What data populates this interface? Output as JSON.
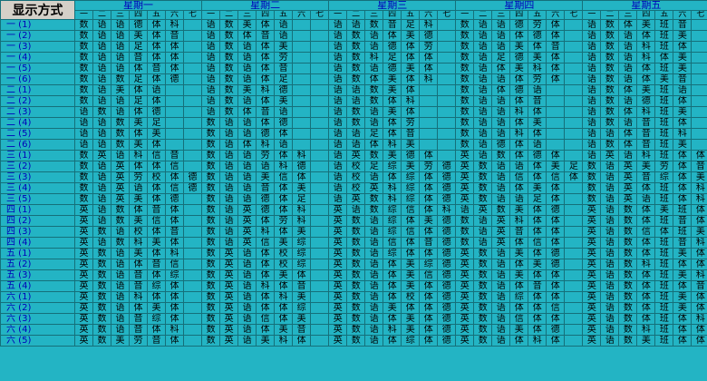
{
  "corner": "显示方式",
  "days": [
    "星期一",
    "星期二",
    "星期三",
    "星期四",
    "星期五"
  ],
  "periods": [
    "一",
    "二",
    "三",
    "四",
    "五",
    "六",
    "七"
  ],
  "rows": [
    {
      "label": "一 (1)",
      "cells": [
        "数",
        "语",
        "语",
        "德",
        "体",
        "科",
        "",
        "语",
        "数",
        "美",
        "体",
        "语",
        "",
        "",
        "语",
        "语",
        "数",
        "音",
        "足",
        "科",
        "",
        "数",
        "语",
        "语",
        "德",
        "劳",
        "体",
        "",
        "语",
        "数",
        "体",
        "美",
        "班",
        "音",
        ""
      ]
    },
    {
      "label": "一 (2)",
      "cells": [
        "数",
        "语",
        "语",
        "美",
        "体",
        "音",
        "",
        "语",
        "数",
        "体",
        "音",
        "语",
        "",
        "",
        "语",
        "数",
        "语",
        "体",
        "美",
        "德",
        "",
        "数",
        "语",
        "语",
        "体",
        "德",
        "体",
        "",
        "语",
        "数",
        "语",
        "体",
        "班",
        "美",
        ""
      ]
    },
    {
      "label": "一 (3)",
      "cells": [
        "数",
        "语",
        "语",
        "足",
        "体",
        "体",
        "",
        "语",
        "数",
        "语",
        "体",
        "美",
        "",
        "",
        "语",
        "数",
        "语",
        "德",
        "体",
        "劳",
        "",
        "数",
        "语",
        "语",
        "美",
        "体",
        "音",
        "",
        "语",
        "数",
        "语",
        "科",
        "班",
        "体",
        ""
      ]
    },
    {
      "label": "一 (4)",
      "cells": [
        "数",
        "语",
        "语",
        "音",
        "体",
        "体",
        "",
        "语",
        "数",
        "语",
        "体",
        "劳",
        "",
        "",
        "语",
        "数",
        "科",
        "足",
        "体",
        "体",
        "",
        "数",
        "语",
        "足",
        "德",
        "美",
        "体",
        "",
        "语",
        "数",
        "语",
        "科",
        "体",
        "美",
        ""
      ]
    },
    {
      "label": "一 (5)",
      "cells": [
        "数",
        "语",
        "语",
        "体",
        "音",
        "体",
        "",
        "语",
        "数",
        "语",
        "体",
        "音",
        "",
        "",
        "语",
        "数",
        "语",
        "德",
        "美",
        "体",
        "",
        "数",
        "语",
        "体",
        "美",
        "科",
        "体",
        "",
        "语",
        "数",
        "语",
        "体",
        "班",
        "美",
        ""
      ]
    },
    {
      "label": "一 (6)",
      "cells": [
        "数",
        "语",
        "数",
        "足",
        "体",
        "德",
        "",
        "语",
        "数",
        "语",
        "体",
        "足",
        "",
        "",
        "语",
        "数",
        "体",
        "美",
        "体",
        "科",
        "",
        "数",
        "语",
        "语",
        "体",
        "劳",
        "体",
        "",
        "语",
        "数",
        "语",
        "体",
        "美",
        "音",
        ""
      ]
    },
    {
      "label": "二 (1)",
      "cells": [
        "数",
        "语",
        "美",
        "体",
        "语",
        "",
        "",
        "语",
        "数",
        "美",
        "科",
        "德",
        "",
        "",
        "语",
        "语",
        "数",
        "美",
        "体",
        "",
        "",
        "数",
        "语",
        "体",
        "德",
        "语",
        "",
        "",
        "语",
        "数",
        "体",
        "美",
        "班",
        "语",
        ""
      ]
    },
    {
      "label": "二 (2)",
      "cells": [
        "数",
        "语",
        "语",
        "足",
        "体",
        "",
        "",
        "语",
        "数",
        "语",
        "体",
        "美",
        "",
        "",
        "语",
        "语",
        "数",
        "体",
        "科",
        "",
        "",
        "数",
        "语",
        "语",
        "体",
        "音",
        "",
        "",
        "语",
        "数",
        "语",
        "德",
        "班",
        "体",
        ""
      ]
    },
    {
      "label": "二 (3)",
      "cells": [
        "语",
        "数",
        "语",
        "体",
        "德",
        "",
        "",
        "语",
        "数",
        "体",
        "音",
        "语",
        "",
        "",
        "语",
        "数",
        "语",
        "美",
        "体",
        "",
        "",
        "数",
        "语",
        "语",
        "科",
        "体",
        "",
        "",
        "语",
        "数",
        "体",
        "科",
        "班",
        "美",
        ""
      ]
    },
    {
      "label": "二 (4)",
      "cells": [
        "语",
        "语",
        "数",
        "美",
        "足",
        "",
        "",
        "数",
        "语",
        "语",
        "体",
        "德",
        "",
        "",
        "语",
        "数",
        "语",
        "体",
        "劳",
        "",
        "",
        "数",
        "语",
        "语",
        "体",
        "美",
        "",
        "",
        "语",
        "数",
        "语",
        "音",
        "班",
        "体",
        ""
      ]
    },
    {
      "label": "二 (5)",
      "cells": [
        "语",
        "语",
        "数",
        "体",
        "美",
        "",
        "",
        "数",
        "语",
        "语",
        "德",
        "体",
        "",
        "",
        "语",
        "语",
        "足",
        "体",
        "音",
        "",
        "",
        "数",
        "语",
        "语",
        "科",
        "体",
        "",
        "",
        "语",
        "语",
        "体",
        "音",
        "班",
        "科",
        ""
      ]
    },
    {
      "label": "二 (6)",
      "cells": [
        "语",
        "语",
        "数",
        "美",
        "体",
        "",
        "",
        "数",
        "语",
        "体",
        "科",
        "语",
        "",
        "",
        "语",
        "语",
        "体",
        "科",
        "美",
        "",
        "",
        "数",
        "语",
        "德",
        "体",
        "语",
        "",
        "",
        "语",
        "数",
        "体",
        "音",
        "班",
        "美",
        ""
      ]
    },
    {
      "label": "三 (1)",
      "cells": [
        "数",
        "英",
        "语",
        "科",
        "信",
        "音",
        "",
        "数",
        "语",
        "语",
        "劳",
        "体",
        "科",
        "",
        "语",
        "英",
        "数",
        "美",
        "德",
        "体",
        "",
        "英",
        "语",
        "数",
        "体",
        "德",
        "体",
        "",
        "语",
        "英",
        "语",
        "科",
        "班",
        "体",
        "体"
      ]
    },
    {
      "label": "三 (2)",
      "cells": [
        "数",
        "语",
        "英",
        "体",
        "体",
        "信",
        "",
        "数",
        "语",
        "语",
        "语",
        "科",
        "德",
        "",
        "语",
        "校",
        "足",
        "综",
        "美",
        "劳",
        "德",
        "英",
        "数",
        "语",
        "语",
        "体",
        "美",
        "足",
        "数",
        "语",
        "英",
        "美",
        "劳",
        "体",
        "音"
      ]
    },
    {
      "label": "三 (3)",
      "cells": [
        "数",
        "语",
        "英",
        "劳",
        "校",
        "体",
        "德",
        "数",
        "语",
        "语",
        "美",
        "信",
        "体",
        "",
        "语",
        "校",
        "语",
        "体",
        "综",
        "体",
        "德",
        "英",
        "数",
        "语",
        "信",
        "体",
        "信",
        "体",
        "数",
        "语",
        "英",
        "音",
        "综",
        "体",
        "美"
      ]
    },
    {
      "label": "三 (4)",
      "cells": [
        "数",
        "语",
        "英",
        "语",
        "体",
        "信",
        "德",
        "数",
        "语",
        "语",
        "音",
        "体",
        "美",
        "",
        "语",
        "校",
        "英",
        "科",
        "综",
        "体",
        "德",
        "英",
        "数",
        "语",
        "体",
        "美",
        "体",
        "",
        "数",
        "语",
        "英",
        "体",
        "班",
        "体",
        "科"
      ]
    },
    {
      "label": "三 (5)",
      "cells": [
        "数",
        "语",
        "英",
        "美",
        "体",
        "德",
        "",
        "数",
        "语",
        "语",
        "德",
        "体",
        "足",
        "",
        "语",
        "英",
        "数",
        "科",
        "综",
        "体",
        "德",
        "英",
        "数",
        "语",
        "语",
        "足",
        "体",
        "",
        "数",
        "语",
        "英",
        "语",
        "班",
        "体",
        "科"
      ]
    },
    {
      "label": "四 (1)",
      "cells": [
        "英",
        "语",
        "数",
        "体",
        "音",
        "体",
        "",
        "数",
        "语",
        "英",
        "德",
        "体",
        "科",
        "",
        "英",
        "语",
        "数",
        "综",
        "信",
        "体",
        "科",
        "语",
        "英",
        "数",
        "美",
        "体",
        "德",
        "",
        "英",
        "语",
        "数",
        "体",
        "美",
        "班",
        "体"
      ]
    },
    {
      "label": "四 (2)",
      "cells": [
        "英",
        "语",
        "数",
        "美",
        "信",
        "体",
        "",
        "数",
        "语",
        "英",
        "体",
        "劳",
        "科",
        "",
        "英",
        "数",
        "语",
        "综",
        "体",
        "美",
        "德",
        "数",
        "语",
        "英",
        "科",
        "体",
        "体",
        "",
        "英",
        "语",
        "数",
        "体",
        "班",
        "音",
        "体"
      ]
    },
    {
      "label": "四 (3)",
      "cells": [
        "英",
        "数",
        "语",
        "校",
        "体",
        "音",
        "",
        "数",
        "语",
        "英",
        "科",
        "体",
        "美",
        "",
        "英",
        "数",
        "语",
        "综",
        "信",
        "体",
        "德",
        "数",
        "语",
        "英",
        "音",
        "体",
        "体",
        "",
        "英",
        "语",
        "数",
        "信",
        "体",
        "班",
        "美"
      ]
    },
    {
      "label": "四 (4)",
      "cells": [
        "英",
        "语",
        "数",
        "科",
        "美",
        "体",
        "",
        "数",
        "语",
        "英",
        "信",
        "美",
        "综",
        "",
        "英",
        "数",
        "语",
        "信",
        "体",
        "音",
        "德",
        "数",
        "语",
        "英",
        "体",
        "信",
        "体",
        "",
        "英",
        "语",
        "数",
        "体",
        "班",
        "音",
        "科"
      ]
    },
    {
      "label": "五 (1)",
      "cells": [
        "英",
        "数",
        "语",
        "美",
        "体",
        "科",
        "",
        "数",
        "英",
        "语",
        "体",
        "校",
        "综",
        "",
        "英",
        "数",
        "语",
        "综",
        "体",
        "体",
        "德",
        "英",
        "数",
        "语",
        "美",
        "体",
        "德",
        "",
        "英",
        "语",
        "数",
        "体",
        "班",
        "美",
        "体"
      ]
    },
    {
      "label": "五 (2)",
      "cells": [
        "英",
        "数",
        "语",
        "体",
        "音",
        "信",
        "",
        "数",
        "英",
        "语",
        "体",
        "校",
        "综",
        "",
        "英",
        "数",
        "语",
        "体",
        "美",
        "综",
        "德",
        "英",
        "数",
        "语",
        "体",
        "美",
        "德",
        "",
        "英",
        "语",
        "数",
        "科",
        "班",
        "体",
        "体"
      ]
    },
    {
      "label": "五 (3)",
      "cells": [
        "英",
        "数",
        "语",
        "音",
        "体",
        "综",
        "",
        "数",
        "英",
        "语",
        "体",
        "美",
        "体",
        "",
        "英",
        "数",
        "语",
        "体",
        "美",
        "信",
        "德",
        "英",
        "数",
        "语",
        "美",
        "体",
        "体",
        "",
        "英",
        "语",
        "数",
        "体",
        "班",
        "美",
        "科"
      ]
    },
    {
      "label": "五 (4)",
      "cells": [
        "英",
        "数",
        "语",
        "音",
        "综",
        "体",
        "",
        "数",
        "英",
        "语",
        "科",
        "体",
        "音",
        "",
        "英",
        "数",
        "语",
        "体",
        "美",
        "体",
        "德",
        "英",
        "数",
        "语",
        "体",
        "音",
        "体",
        "",
        "英",
        "语",
        "数",
        "体",
        "班",
        "体",
        "音"
      ]
    },
    {
      "label": "六 (1)",
      "cells": [
        "英",
        "数",
        "语",
        "科",
        "体",
        "体",
        "",
        "数",
        "英",
        "语",
        "体",
        "科",
        "美",
        "",
        "英",
        "数",
        "语",
        "体",
        "校",
        "体",
        "德",
        "英",
        "数",
        "语",
        "综",
        "体",
        "体",
        "",
        "英",
        "语",
        "数",
        "体",
        "班",
        "美",
        "体"
      ]
    },
    {
      "label": "六 (2)",
      "cells": [
        "英",
        "数",
        "语",
        "体",
        "美",
        "体",
        "",
        "数",
        "英",
        "语",
        "体",
        "体",
        "综",
        "",
        "英",
        "数",
        "语",
        "美",
        "体",
        "体",
        "德",
        "英",
        "数",
        "语",
        "体",
        "体",
        "信",
        "",
        "英",
        "语",
        "数",
        "体",
        "班",
        "美",
        "体"
      ]
    },
    {
      "label": "六 (3)",
      "cells": [
        "英",
        "数",
        "语",
        "音",
        "综",
        "体",
        "",
        "数",
        "英",
        "语",
        "信",
        "体",
        "美",
        "",
        "英",
        "数",
        "语",
        "体",
        "美",
        "体",
        "德",
        "英",
        "数",
        "语",
        "信",
        "体",
        "体",
        "",
        "英",
        "语",
        "数",
        "体",
        "班",
        "体",
        "科"
      ]
    },
    {
      "label": "六 (4)",
      "cells": [
        "英",
        "数",
        "语",
        "音",
        "体",
        "科",
        "",
        "数",
        "英",
        "语",
        "体",
        "美",
        "音",
        "",
        "英",
        "数",
        "语",
        "科",
        "美",
        "体",
        "德",
        "英",
        "数",
        "语",
        "美",
        "体",
        "德",
        "",
        "英",
        "语",
        "数",
        "科",
        "班",
        "体",
        "体"
      ]
    },
    {
      "label": "六 (5)",
      "cells": [
        "英",
        "数",
        "美",
        "劳",
        "音",
        "体",
        "",
        "数",
        "英",
        "语",
        "美",
        "科",
        "体",
        "",
        "英",
        "数",
        "语",
        "体",
        "综",
        "体",
        "德",
        "英",
        "数",
        "语",
        "体",
        "科",
        "体",
        "",
        "英",
        "语",
        "数",
        "美",
        "班",
        "体",
        "体"
      ]
    }
  ]
}
